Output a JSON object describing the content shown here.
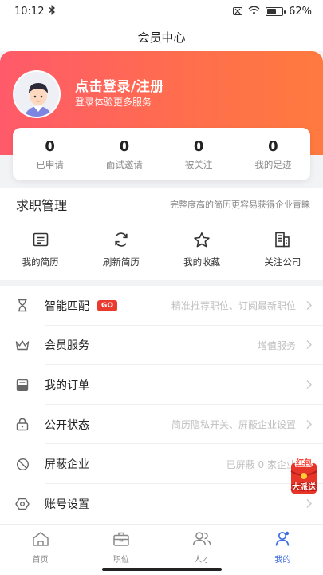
{
  "status": {
    "time": "10:12",
    "battery": "62%",
    "battery_level": 0.62
  },
  "page_title": "会员中心",
  "profile": {
    "login_title": "点击登录/注册",
    "login_sub": "登录体验更多服务"
  },
  "stats": [
    {
      "num": "0",
      "label": "已申请"
    },
    {
      "num": "0",
      "label": "面试邀请"
    },
    {
      "num": "0",
      "label": "被关注"
    },
    {
      "num": "0",
      "label": "我的足迹"
    }
  ],
  "job_section": {
    "title": "求职管理",
    "hint": "完整度高的简历更容易获得企业青睐",
    "items": [
      {
        "label": "我的简历",
        "icon": "resume-icon"
      },
      {
        "label": "刷新简历",
        "icon": "refresh-icon"
      },
      {
        "label": "我的收藏",
        "icon": "star-icon"
      },
      {
        "label": "关注公司",
        "icon": "building-icon"
      }
    ]
  },
  "menu": [
    {
      "label": "智能匹配",
      "badge": "GO",
      "hint": "精准推荐职位、订阅最新职位",
      "icon": "hourglass-icon"
    },
    {
      "label": "会员服务",
      "hint": "增值服务",
      "icon": "crown-icon"
    },
    {
      "label": "我的订单",
      "hint": "",
      "icon": "order-icon"
    },
    {
      "label": "公开状态",
      "hint": "简历隐私开关、屏蔽企业设置",
      "icon": "lock-icon"
    },
    {
      "label": "屏蔽企业",
      "hint": "已屏蔽 0 家企业",
      "icon": "block-icon"
    },
    {
      "label": "账号设置",
      "hint": "",
      "icon": "settings-icon"
    }
  ],
  "redpacket": {
    "line1": "红包",
    "line2": "大派送"
  },
  "tabs": [
    {
      "label": "首页",
      "icon": "home-icon",
      "active": false
    },
    {
      "label": "职位",
      "icon": "briefcase-icon",
      "active": false
    },
    {
      "label": "人才",
      "icon": "people-icon",
      "active": false
    },
    {
      "label": "我的",
      "icon": "user-icon",
      "active": true
    }
  ],
  "colors": {
    "brand_gradient_start": "#ff5a6a",
    "brand_gradient_end": "#ff7a3f",
    "active_tab": "#3f6fdf",
    "badge": "#ea3a2e"
  }
}
